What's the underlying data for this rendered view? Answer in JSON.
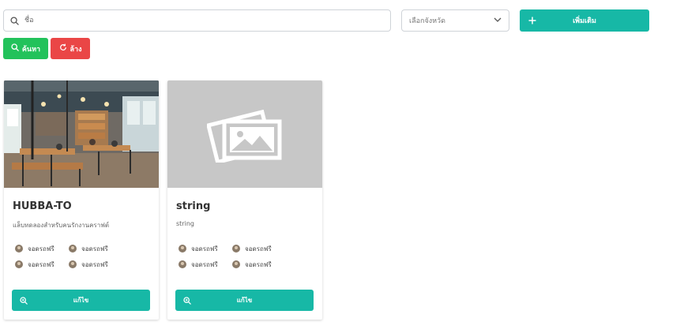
{
  "filters": {
    "search_placeholder": "ชื่อ",
    "province_placeholder": "เลือกจังหวัด",
    "add_label": "เพิ่มเติม",
    "search_label": "ค้นหา",
    "clear_label": "ล้าง"
  },
  "colors": {
    "teal": "#17b8a6",
    "green": "#22c25b",
    "red": "#ea4646"
  },
  "cards": [
    {
      "title": "HUBBA-TO",
      "description": "แล็บทดลองสำหรับคนรักงานคราฟต์",
      "image": "coworking-photo",
      "amenities": [
        "จอดรถฟรี",
        "จอดรถฟรี",
        "จอดรถฟรี",
        "จอดรถฟรี"
      ],
      "edit_label": "แก้ไข"
    },
    {
      "title": "string",
      "description": "string",
      "image": "image-placeholder-icon",
      "amenities": [
        "จอดรถฟรี",
        "จอดรถฟรี",
        "จอดรถฟรี",
        "จอดรถฟรี"
      ],
      "edit_label": "แก้ไข"
    }
  ]
}
